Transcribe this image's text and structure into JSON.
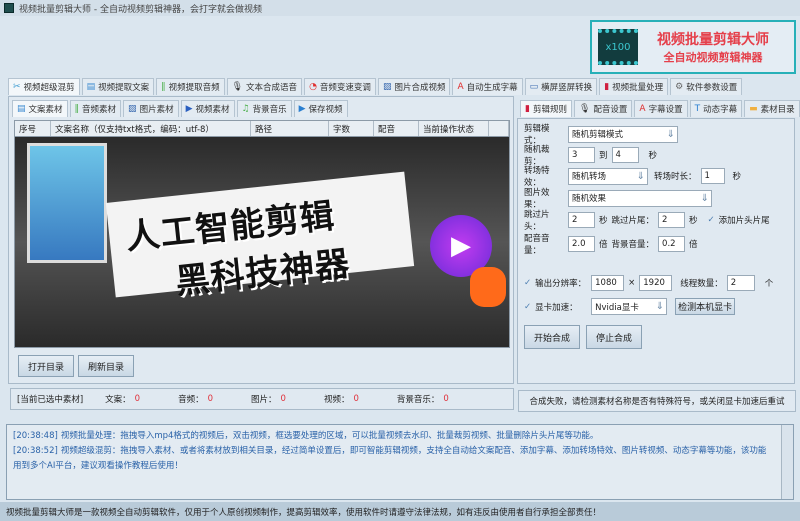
{
  "window": {
    "title": "视频批量剪辑大师 - 全自动视频剪辑神器，会打字就会做视频"
  },
  "logo": {
    "badge": "x100",
    "line1": "视频批量剪辑大师",
    "line2": "全自动视频剪辑神器"
  },
  "main_tabs": [
    {
      "label": "视频超级混剪",
      "icon": "scissors-icon",
      "active": true
    },
    {
      "label": "视频提取文案",
      "icon": "document-icon"
    },
    {
      "label": "视频提取音频",
      "icon": "waveform-icon"
    },
    {
      "label": "文本合成语音",
      "icon": "microphone-icon"
    },
    {
      "label": "音频变速变调",
      "icon": "gauge-icon"
    },
    {
      "label": "图片合成视频",
      "icon": "image-icon"
    },
    {
      "label": "自动生成字幕",
      "icon": "subtitle-icon"
    },
    {
      "label": "横屏竖屏转换",
      "icon": "rotate-screen-icon"
    },
    {
      "label": "视频批量处理",
      "icon": "film-icon"
    },
    {
      "label": "软件参数设置",
      "icon": "gear-icon"
    }
  ],
  "material_tabs": [
    {
      "label": "文案素材",
      "icon": "document-icon",
      "active": true
    },
    {
      "label": "音频素材",
      "icon": "waveform-icon"
    },
    {
      "label": "图片素材",
      "icon": "image-icon"
    },
    {
      "label": "视频素材",
      "icon": "play-icon"
    },
    {
      "label": "背景音乐",
      "icon": "music-icon"
    },
    {
      "label": "保存视频",
      "icon": "save-video-icon"
    }
  ],
  "table": {
    "columns": [
      "序号",
      "文案名称（仅支持txt格式，编码：utf-8）",
      "路径",
      "字数",
      "配音",
      "当前操作状态"
    ]
  },
  "preview": {
    "line1": "人工智能剪辑",
    "line2": "黑科技神器"
  },
  "buttons": {
    "open_dir": "打开目录",
    "refresh_dir": "刷新目录",
    "start": "开始合成",
    "stop": "停止合成",
    "detect_gpu": "检测本机显卡"
  },
  "selection": {
    "label": "[当前已选中素材]",
    "items": [
      {
        "label": "文案：",
        "value": "0"
      },
      {
        "label": "音频：",
        "value": "0"
      },
      {
        "label": "图片：",
        "value": "0"
      },
      {
        "label": "视频：",
        "value": "0"
      },
      {
        "label": "背景音乐：",
        "value": "0"
      }
    ]
  },
  "settings_tabs": [
    {
      "label": "剪辑规则",
      "icon": "film-icon",
      "active": true
    },
    {
      "label": "配音设置",
      "icon": "microphone-icon"
    },
    {
      "label": "字幕设置",
      "icon": "subtitle-icon"
    },
    {
      "label": "动态字幕",
      "icon": "text-box-icon"
    },
    {
      "label": "素材目录",
      "icon": "folder-icon"
    }
  ],
  "settings": {
    "edit_mode": {
      "label": "剪辑模式：",
      "value": "随机剪辑模式"
    },
    "random_cut": {
      "label": "随机裁剪：",
      "from": "3",
      "to_label": "到",
      "to": "4",
      "unit": "秒"
    },
    "transition": {
      "label": "转场特效：",
      "value": "随机转场",
      "duration_label": "转场时长：",
      "duration": "1",
      "unit": "秒"
    },
    "image_effect": {
      "label": "图片效果：",
      "value": "随机效果"
    },
    "skip_head": {
      "label": "跳过片头：",
      "value": "2",
      "unit": "秒"
    },
    "skip_tail": {
      "label": "跳过片尾：",
      "value": "2",
      "unit": "秒"
    },
    "add_head_tail": {
      "label": "添加片头片尾",
      "checked": true
    },
    "voice_volume": {
      "label": "配音音量：",
      "value": "2.0",
      "unit": "倍"
    },
    "bg_volume": {
      "label": "背景音量：",
      "value": "0.2",
      "unit": "倍"
    },
    "resolution": {
      "label": "输出分辨率：",
      "checked": true,
      "width": "1080",
      "x": "×",
      "height": "1920"
    },
    "threads": {
      "label": "线程数量：",
      "value": "2",
      "unit": "个"
    },
    "gpu": {
      "label": "显卡加速：",
      "checked": true,
      "value": "Nvidia显卡"
    }
  },
  "status_right": "合成失败，请检测素材名称是否有特殊符号，或关闭显卡加速后重试",
  "log": [
    {
      "time": "[20:38:48]",
      "text": "视频批量处理：拖拽导入mp4格式的视频后，双击视频，框选要处理的区域，可以批量视频去水印、批量裁剪视频、批量删除片头片尾等功能。"
    },
    {
      "time": "[20:38:52]",
      "text": "视频超级混剪：拖拽导入素材、或者将素材放到相关目录，经过简单设置后，即可智能剪辑视频，支持全自动给文案配音、添加字幕、添加转场特效、图片转视频、动态字幕等功能，该功能用到多个AI平台，建议观看操作教程后使用！"
    }
  ],
  "footer": "视频批量剪辑大师是一款视频全自动剪辑软件，仅用于个人原创视频制作，提高剪辑效率，使用软件时请遵守法律法规，如有违反由使用者自行承担全部责任！",
  "colors": {
    "accent": "#27b0b8",
    "logo_text": "#e53f4a",
    "count": "#e0303a",
    "log_text": "#2a62a8"
  }
}
